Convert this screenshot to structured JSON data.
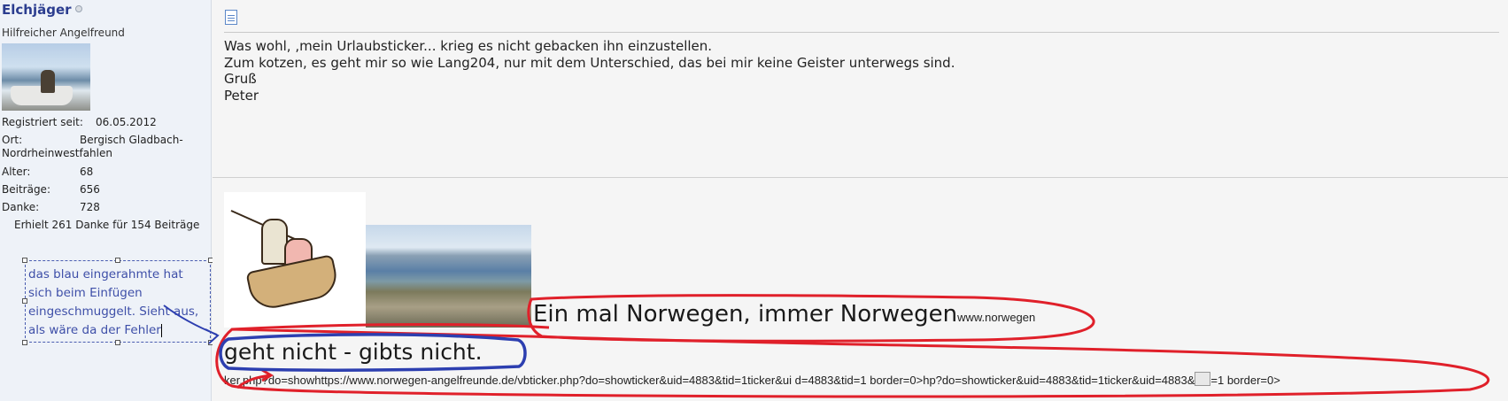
{
  "user": {
    "name": "Elchjäger",
    "title": "Hilfreicher Angelfreund",
    "stats": {
      "registered_label": "Registriert seit:",
      "registered_value": "06.05.2012",
      "location_label": "Ort:",
      "location_value_1": "Bergisch Gladbach-",
      "location_value_2": "Nordrheinwestfahlen",
      "age_label": "Alter:",
      "age_value": "68",
      "posts_label": "Beiträge:",
      "posts_value": "656",
      "thanks_label": "Danke:",
      "thanks_value": "728"
    },
    "thanks_received": "Erhielt 261 Danke für 154 Beiträge"
  },
  "annotation": {
    "line1": "das blau eingerahmte hat",
    "line2": "sich beim Einfügen",
    "line3": "eingeschmuggelt. Sieht aus,",
    "line4": "als wäre da der Fehler",
    "color": "#3e4fa8"
  },
  "post": {
    "line1": "Was wohl, ‚mein Urlaubsticker... krieg es nicht gebacken ihn einzustellen.",
    "line2": "Zum kotzen, es geht mir so wie Lang204, nur mit dem Unterschied, das bei mir keine Geister unterwegs sind.",
    "line3": "Gruß",
    "line4": "Peter"
  },
  "signature": {
    "norway_big": "Ein mal Norwegen, immer Norwegen",
    "norway_small": "www.norwegen",
    "geht_nicht": "geht nicht - gibts nicht.",
    "url_part1": "ker.ph",
    "url_part2": "p?do=showhttps://www.norwegen-angelfreunde.de/vbticker.php?do=showticker&uid=4883&tid=1ticker&ui d=4883&tid=1 border=0>hp?do=showticker&uid=4883&tid=1ticker&uid=4883&",
    "url_part3": "=1 border=0>"
  },
  "colors": {
    "red_annotation": "#e0202a",
    "blue_annotation": "#2d3fb0",
    "username": "#2b3d8f"
  }
}
